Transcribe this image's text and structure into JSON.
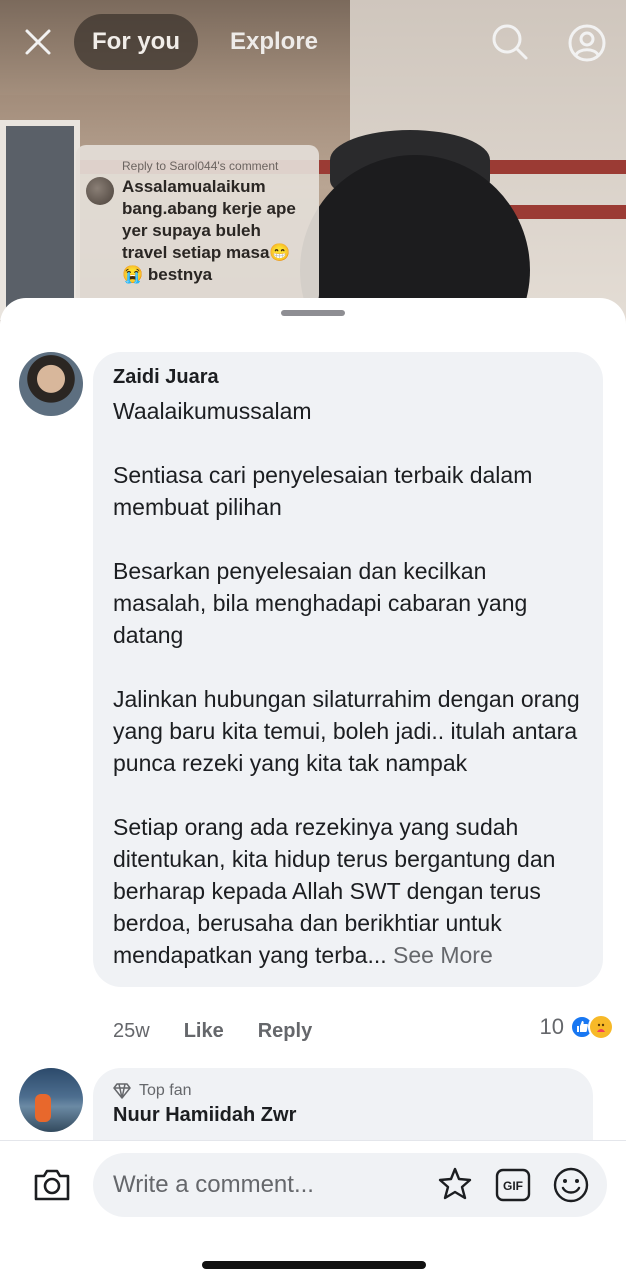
{
  "top_nav": {
    "tabs": [
      {
        "label": "For you",
        "active": true
      },
      {
        "label": "Explore",
        "active": false
      }
    ]
  },
  "reply_sticker": {
    "header": "Reply to Sarol044's comment",
    "text": "Assalamualaikum bang.abang kerje ape yer supaya buleh travel setiap masa😁😭 bestnya"
  },
  "comments": [
    {
      "author": "Zaidi Juara",
      "paragraphs": [
        "Waalaikumussalam",
        "Sentiasa cari penyelesaian terbaik dalam membuat pilihan",
        "Besarkan penyelesaian dan kecilkan masalah, bila menghadapi cabaran yang datang",
        "Jalinkan hubungan silaturrahim dengan orang yang baru kita temui, boleh jadi.. itulah antara punca rezeki yang kita tak nampak",
        "Setiap orang ada rezekinya yang sudah ditentukan, kita hidup terus bergantung dan berharap kepada Allah SWT dengan terus berdoa, berusaha dan berikhtiar untuk mendapatkan yang terba..."
      ],
      "see_more": "See More",
      "time": "25w",
      "like_label": "Like",
      "reply_label": "Reply",
      "reaction_count": "10"
    },
    {
      "badge": "Top fan",
      "author": "Nuur Hamiidah Zwr"
    }
  ],
  "composer": {
    "placeholder": "Write a comment..."
  },
  "colors": {
    "like_blue": "#1877f2",
    "bubble_bg": "#f0f2f5",
    "secondary_text": "#65676b"
  }
}
